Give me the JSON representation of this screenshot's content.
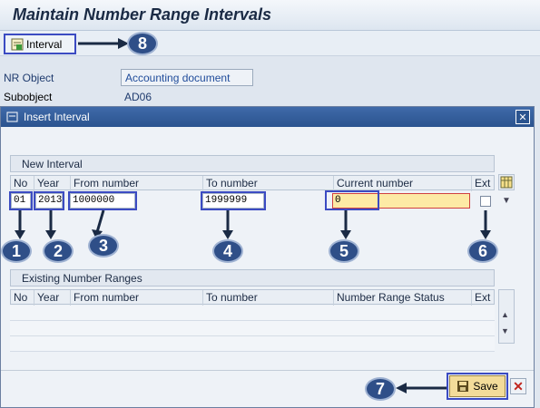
{
  "header": {
    "title": "Maintain Number Range Intervals"
  },
  "toolbar": {
    "interval_label": "Interval"
  },
  "form": {
    "nr_object_label": "NR Object",
    "nr_object_value": "Accounting document",
    "subobject_label": "Subobject",
    "subobject_value": "AD06"
  },
  "dialog": {
    "title": "Insert Interval",
    "new_interval": {
      "group_title": "New Interval",
      "headers": [
        "No",
        "Year",
        "From number",
        "To number",
        "Current number",
        "Ext"
      ],
      "row": {
        "no": "01",
        "year": "2013",
        "from": "1000000",
        "to": "1999999",
        "current": "0",
        "ext": false
      }
    },
    "existing": {
      "group_title": "Existing Number Ranges",
      "headers": [
        "No",
        "Year",
        "From number",
        "To number",
        "Number Range Status",
        "Ext"
      ]
    },
    "save_label": "Save"
  },
  "callouts": [
    "1",
    "2",
    "3",
    "4",
    "5",
    "6",
    "7",
    "8"
  ],
  "colors": {
    "accent": "#2f4f88",
    "highlight_border": "#3b4bc2",
    "dialog_header": "#2b548f",
    "save_bg": "#f3dc9a"
  }
}
